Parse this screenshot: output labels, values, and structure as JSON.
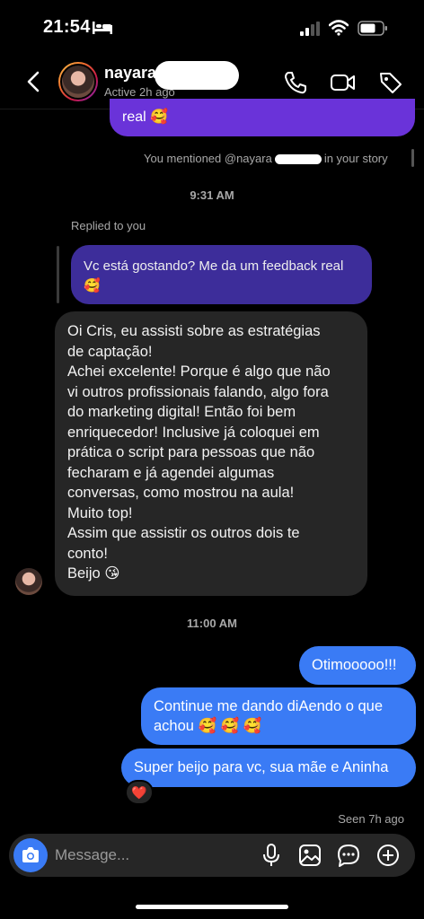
{
  "status_bar": {
    "time": "21:54"
  },
  "header": {
    "name": "nayara",
    "status": "Active 2h ago"
  },
  "messages": {
    "top_bubble": "real 🥰",
    "mention_prefix": "You mentioned @nayara",
    "mention_suffix": "in your story",
    "time_1": "9:31 AM",
    "replied_label": "Replied to you",
    "reply_lines": [
      "Vc está gostando? Me da um feedback real",
      "🥰"
    ],
    "incoming_lines": [
      "Oi Cris, eu assisti sobre as estratégias",
      "de captação!",
      "Achei excelente! Porque é algo que não",
      "vi outros profissionais falando, algo fora",
      "do marketing digital! Então foi bem",
      "enriquecedor! Inclusive já coloquei em",
      "prática o script para pessoas que não",
      "fecharam e já agendei algumas",
      "conversas, como mostrou na aula!",
      "Muito top!",
      "Assim que assistir os outros dois te",
      "conto!",
      "Beijo 😘"
    ],
    "time_2": "11:00 AM",
    "out_1": "Otimooooo!!!",
    "out_2_lines": [
      "Continue me dando diAendo o que",
      "achou 🥰 🥰 🥰"
    ],
    "out_3": "Super beijo para vc, sua mãe e Aninha",
    "reaction": "❤️",
    "seen": "Seen 7h ago"
  },
  "composer": {
    "placeholder": "Message..."
  },
  "colors": {
    "outgoing": "#3a7bf5",
    "incoming": "#262626",
    "reply": "#3d2d9a",
    "story": "#6a33d9"
  },
  "icons": [
    "bed-icon",
    "signal-icon",
    "wifi-icon",
    "battery-icon",
    "back-icon",
    "phone-icon",
    "video-icon",
    "tag-icon",
    "camera-icon",
    "mic-icon",
    "gallery-icon",
    "sticker-icon",
    "plus-icon"
  ]
}
